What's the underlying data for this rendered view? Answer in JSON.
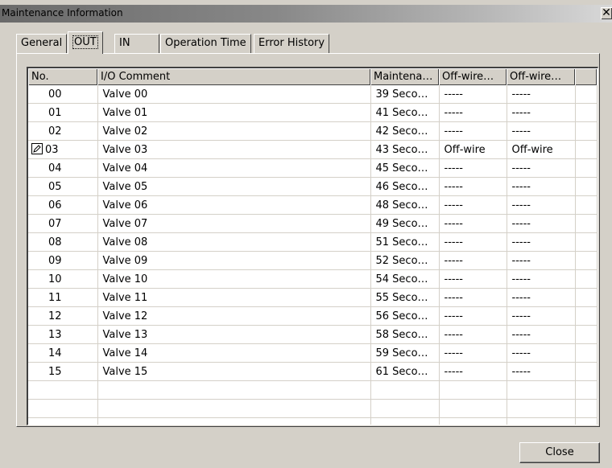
{
  "window": {
    "title": "Maintenance Information",
    "close_glyph": "✕"
  },
  "tabs": [
    {
      "label": "General",
      "active": false
    },
    {
      "label": "OUT",
      "active": true
    },
    {
      "label": "IN",
      "active": false
    },
    {
      "label": "Operation Time",
      "active": false
    },
    {
      "label": "Error History",
      "active": false
    }
  ],
  "table": {
    "headers": [
      "No.",
      "I/O Comment",
      "Maintena…",
      "Off-wire…",
      "Off-wire…",
      ""
    ],
    "rows": [
      {
        "no": "00",
        "comment": "Valve 00",
        "maint": "39 Seco…",
        "off1": "-----",
        "off2": "-----",
        "edit_icon": false
      },
      {
        "no": "01",
        "comment": "Valve 01",
        "maint": "41 Seco…",
        "off1": "-----",
        "off2": "-----",
        "edit_icon": false
      },
      {
        "no": "02",
        "comment": "Valve 02",
        "maint": "42 Seco…",
        "off1": "-----",
        "off2": "-----",
        "edit_icon": false
      },
      {
        "no": "03",
        "comment": "Valve 03",
        "maint": "43 Seco…",
        "off1": "Off-wire",
        "off2": "Off-wire",
        "edit_icon": true
      },
      {
        "no": "04",
        "comment": "Valve 04",
        "maint": "45 Seco…",
        "off1": "-----",
        "off2": "-----",
        "edit_icon": false
      },
      {
        "no": "05",
        "comment": "Valve 05",
        "maint": "46 Seco…",
        "off1": "-----",
        "off2": "-----",
        "edit_icon": false
      },
      {
        "no": "06",
        "comment": "Valve 06",
        "maint": "48 Seco…",
        "off1": "-----",
        "off2": "-----",
        "edit_icon": false
      },
      {
        "no": "07",
        "comment": "Valve 07",
        "maint": "49 Seco…",
        "off1": "-----",
        "off2": "-----",
        "edit_icon": false
      },
      {
        "no": "08",
        "comment": "Valve 08",
        "maint": "51 Seco…",
        "off1": "-----",
        "off2": "-----",
        "edit_icon": false
      },
      {
        "no": "09",
        "comment": "Valve 09",
        "maint": "52 Seco…",
        "off1": "-----",
        "off2": "-----",
        "edit_icon": false
      },
      {
        "no": "10",
        "comment": "Valve 10",
        "maint": "54 Seco…",
        "off1": "-----",
        "off2": "-----",
        "edit_icon": false
      },
      {
        "no": "11",
        "comment": "Valve 11",
        "maint": "55 Seco…",
        "off1": "-----",
        "off2": "-----",
        "edit_icon": false
      },
      {
        "no": "12",
        "comment": "Valve 12",
        "maint": "56 Seco…",
        "off1": "-----",
        "off2": "-----",
        "edit_icon": false
      },
      {
        "no": "13",
        "comment": "Valve 13",
        "maint": "58 Seco…",
        "off1": "-----",
        "off2": "-----",
        "edit_icon": false
      },
      {
        "no": "14",
        "comment": "Valve 14",
        "maint": "59 Seco…",
        "off1": "-----",
        "off2": "-----",
        "edit_icon": false
      },
      {
        "no": "15",
        "comment": "Valve 15",
        "maint": "61 Seco…",
        "off1": "-----",
        "off2": "-----",
        "edit_icon": false
      },
      {
        "no": "",
        "comment": "",
        "maint": "",
        "off1": "",
        "off2": "",
        "edit_icon": false
      },
      {
        "no": "",
        "comment": "",
        "maint": "",
        "off1": "",
        "off2": "",
        "edit_icon": false
      },
      {
        "no": "",
        "comment": "",
        "maint": "",
        "off1": "",
        "off2": "",
        "edit_icon": false
      }
    ]
  },
  "buttons": {
    "close_label": "Close"
  }
}
